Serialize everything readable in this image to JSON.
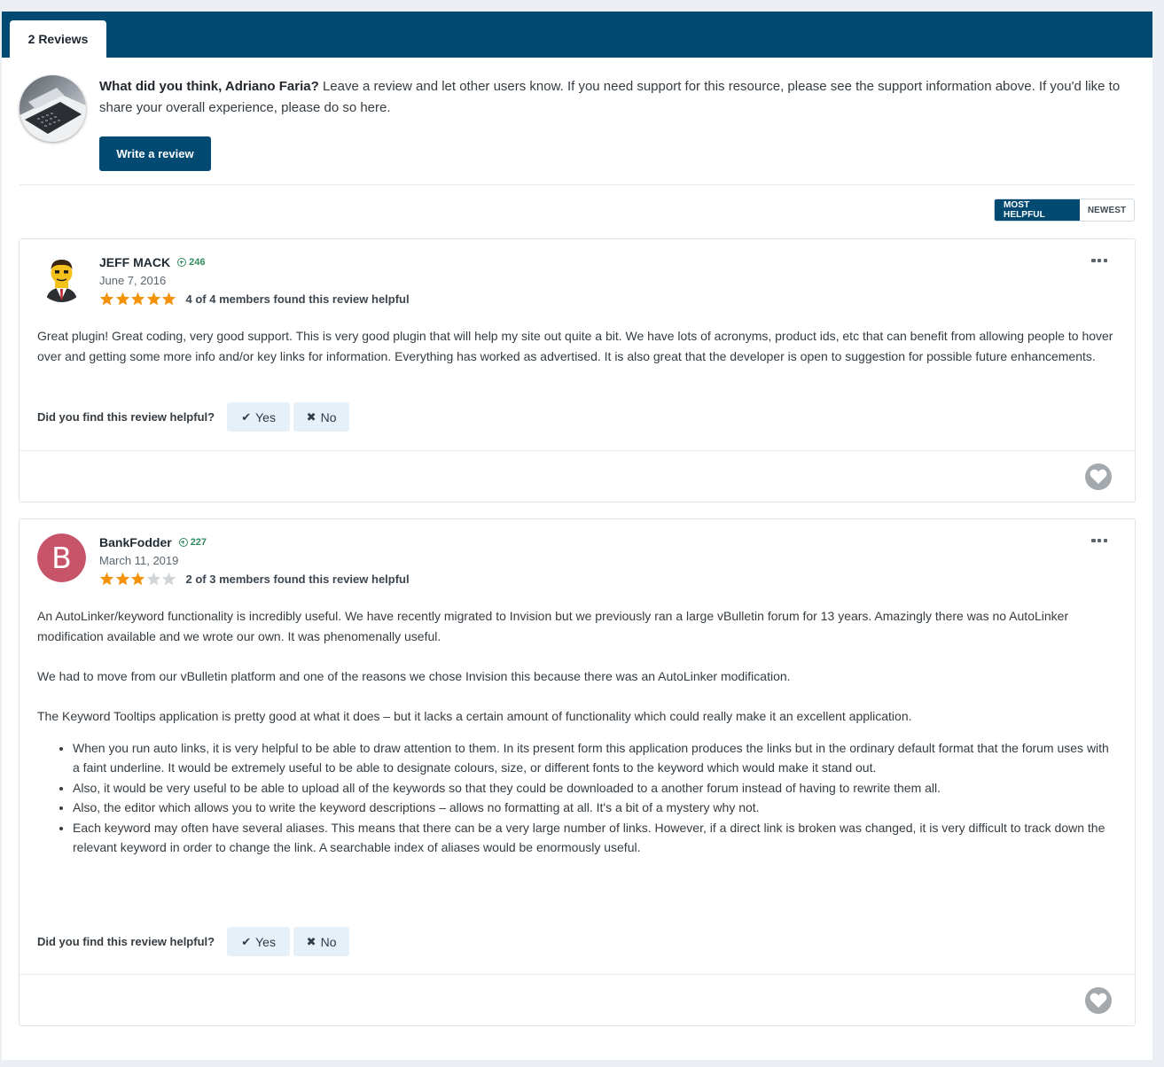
{
  "tabs": {
    "reviews_label": "2 Reviews"
  },
  "prompt": {
    "lead": "What did you think, Adriano Faria?",
    "text": " Leave a review and let other users know. If you need support for this resource, please see the support information above. If you'd like to share your overall experience, please do so here.",
    "write_button": "Write a review"
  },
  "sort": {
    "most_helpful": "MOST HELPFUL",
    "newest": "NEWEST"
  },
  "reviews": [
    {
      "author": "JEFF MACK",
      "reputation": "246",
      "date": "June 7, 2016",
      "rating": 5,
      "helpful_summary": "4 of 4 members found this review helpful",
      "body": [
        "Great plugin!  Great coding, very good support.  This is very good plugin that will help my site out quite a bit.  We have lots of acronyms, product ids, etc that can benefit from allowing people to hover over and getting some more info and/or key links for information.  Everything has worked as advertised.  It is also great that the developer is open to suggestion for possible future enhancements."
      ],
      "helpful_question": "Did you find this review helpful?",
      "yes_label": "Yes",
      "no_label": "No"
    },
    {
      "author": "BankFodder",
      "avatar_letter": "B",
      "reputation": "227",
      "date": "March 11, 2019",
      "rating": 3,
      "helpful_summary": "2 of 3 members found this review helpful",
      "body": [
        "An AutoLinker/keyword functionality is incredibly useful. We have recently migrated to Invision but we previously ran a large vBulletin forum for 13 years. Amazingly there was no AutoLinker modification available and we wrote our own. It was phenomenally useful.",
        "We had to move from our vBulletin platform and one of the reasons we chose Invision this because there was an AutoLinker modification.",
        "The Keyword Tooltips application is pretty good at what it does – but it lacks a certain amount of functionality which could really make it an excellent application."
      ],
      "bullets": [
        "When you run auto links, it is very helpful to be able to draw attention to them. In its present form this application produces the links but in the ordinary default format that the forum uses with a faint underline. It would be extremely useful to be able to designate colours, size, or different fonts to the keyword which would make it stand out.",
        "Also, it would be very useful to be able to upload all of the keywords so that they could be downloaded to a another forum instead of having to rewrite them all.",
        "Also, the editor which allows you to write the keyword descriptions – allows no formatting at all. It's a bit of a mystery why not.",
        "Each keyword may often have several aliases. This means that there can be a very large number of links. However, if a direct link is broken was changed, it is very difficult to track down the relevant keyword in order to change the link. A searchable index of aliases would be enormously useful."
      ],
      "helpful_question": "Did you find this review helpful?",
      "yes_label": "Yes",
      "no_label": "No"
    }
  ],
  "icons": {
    "ellipsis": "ellipsis-icon",
    "heart": "heart-icon",
    "check": "check-icon",
    "x": "x-icon",
    "reputation": "plus-circle-icon"
  },
  "colors": {
    "brand": "#034a73",
    "star": "#f4920b",
    "star_empty": "#d1d5d9",
    "reputation": "#2e8a5e",
    "letter_avatar": "#c8546a"
  }
}
